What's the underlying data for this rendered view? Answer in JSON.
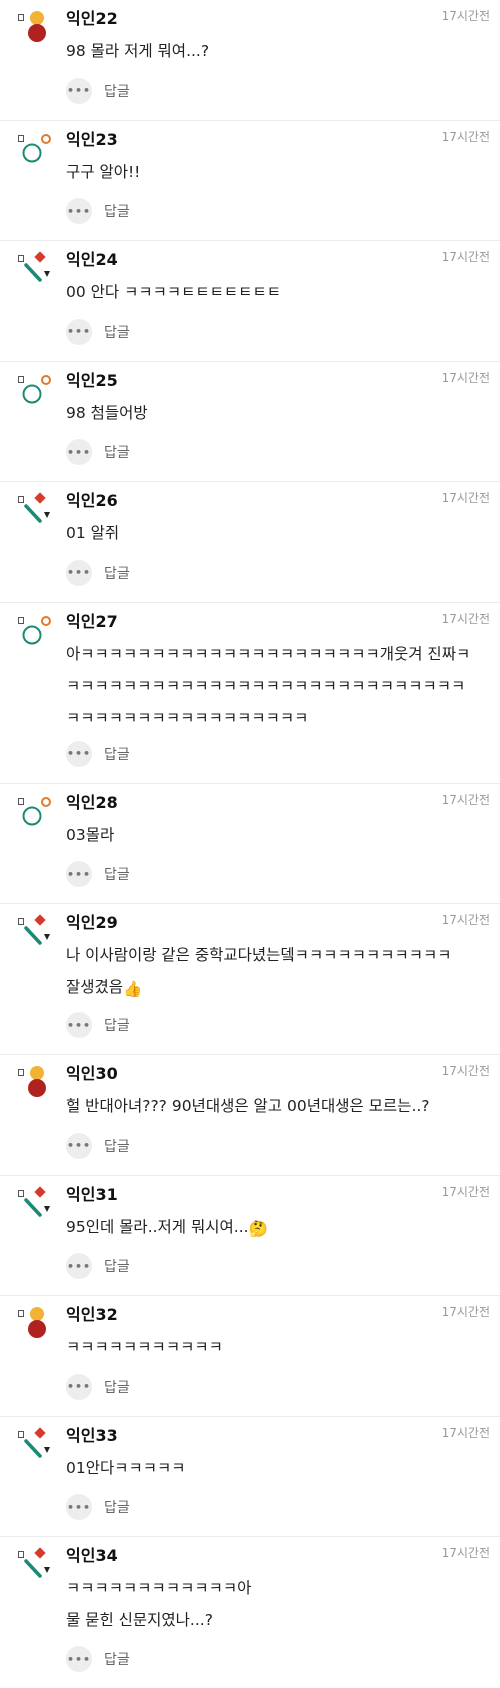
{
  "reply_label": "답글",
  "more_glyph": "•••",
  "comments": [
    {
      "name": "익인22",
      "time": "17시간전",
      "text": "98 몰라 저게 뭐여...?",
      "avatar": "person"
    },
    {
      "name": "익인23",
      "time": "17시간전",
      "text": "구구 알아!!",
      "avatar": "circles"
    },
    {
      "name": "익인24",
      "time": "17시간전",
      "text": "00 안다 ㅋㅋㅋㅋㅌㅌㅌㅌㅌㅌㅌ",
      "avatar": "shapes"
    },
    {
      "name": "익인25",
      "time": "17시간전",
      "text": "98 첨들어방",
      "avatar": "circles"
    },
    {
      "name": "익인26",
      "time": "17시간전",
      "text": "01 알쥐",
      "avatar": "shapes"
    },
    {
      "name": "익인27",
      "time": "17시간전",
      "text": "아ㅋㅋㅋㅋㅋㅋㅋㅋㅋㅋㅋㅋㅋㅋㅋㅋㅋㅋㅋㅋㅋ개웃겨 진짜ㅋ\nㅋㅋㅋㅋㅋㅋㅋㅋㅋㅋㅋㅋㅋㅋㅋㅋㅋㅋㅋㅋㅋㅋㅋㅋㅋㅋㅋㅋ\nㅋㅋㅋㅋㅋㅋㅋㅋㅋㅋㅋㅋㅋㅋㅋㅋㅋ",
      "avatar": "circles"
    },
    {
      "name": "익인28",
      "time": "17시간전",
      "text": "03몰라",
      "avatar": "circles"
    },
    {
      "name": "익인29",
      "time": "17시간전",
      "text": "나 이사람이랑 같은 중학교다녔는뎈ㅋㅋㅋㅋㅋㅋㅋㅋㅋㅋㅋ\n잘생겼음",
      "emoji": "👍",
      "avatar": "shapes"
    },
    {
      "name": "익인30",
      "time": "17시간전",
      "text": "헐 반대아녀??? 90년대생은 알고 00년대생은 모르는..?",
      "avatar": "person"
    },
    {
      "name": "익인31",
      "time": "17시간전",
      "text": "95인데 몰라..저게 뭐시여...",
      "emoji": "🤔",
      "avatar": "shapes"
    },
    {
      "name": "익인32",
      "time": "17시간전",
      "text": "ㅋㅋㅋㅋㅋㅋㅋㅋㅋㅋㅋ",
      "avatar": "person"
    },
    {
      "name": "익인33",
      "time": "17시간전",
      "text": "01안다ㅋㅋㅋㅋㅋ",
      "avatar": "shapes"
    },
    {
      "name": "익인34",
      "time": "17시간전",
      "text": "ㅋㅋㅋㅋㅋㅋㅋㅋㅋㅋㅋㅋ아\n물 묻힌 신문지였나...?",
      "avatar": "shapes"
    }
  ]
}
